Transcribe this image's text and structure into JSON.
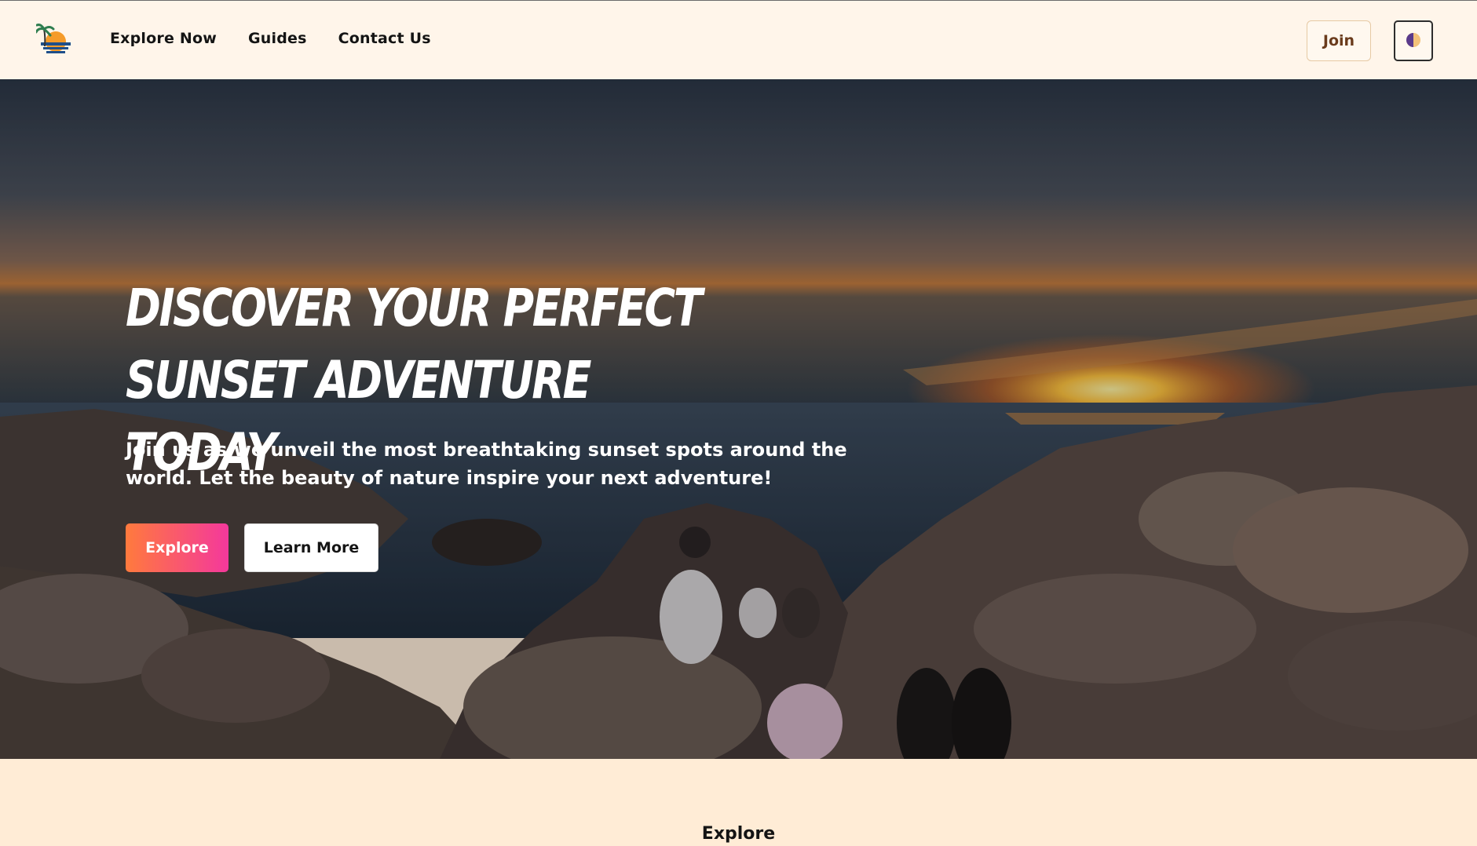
{
  "header": {
    "nav": [
      "Explore Now",
      "Guides",
      "Contact Us"
    ],
    "join_label": "Join"
  },
  "icons": {
    "logo": "palm-sunset-logo-icon",
    "theme": "theme-toggle-moon-icon"
  },
  "hero": {
    "title": "Discover Your Perfect Sunset Adventure Today",
    "subtitle": "Join us as we unveil the most breathtaking sunset spots around the world. Let the beauty of nature inspire your next adventure!",
    "explore_label": "Explore",
    "learn_more_label": "Learn More"
  },
  "section": {
    "title": "Explore"
  },
  "colors": {
    "header_bg": "#fff5ea",
    "page_bg": "#ffecd6",
    "explore_gradient_start": "#ff7a3d",
    "explore_gradient_end": "#f4389c",
    "join_text": "#6a3b1c"
  }
}
